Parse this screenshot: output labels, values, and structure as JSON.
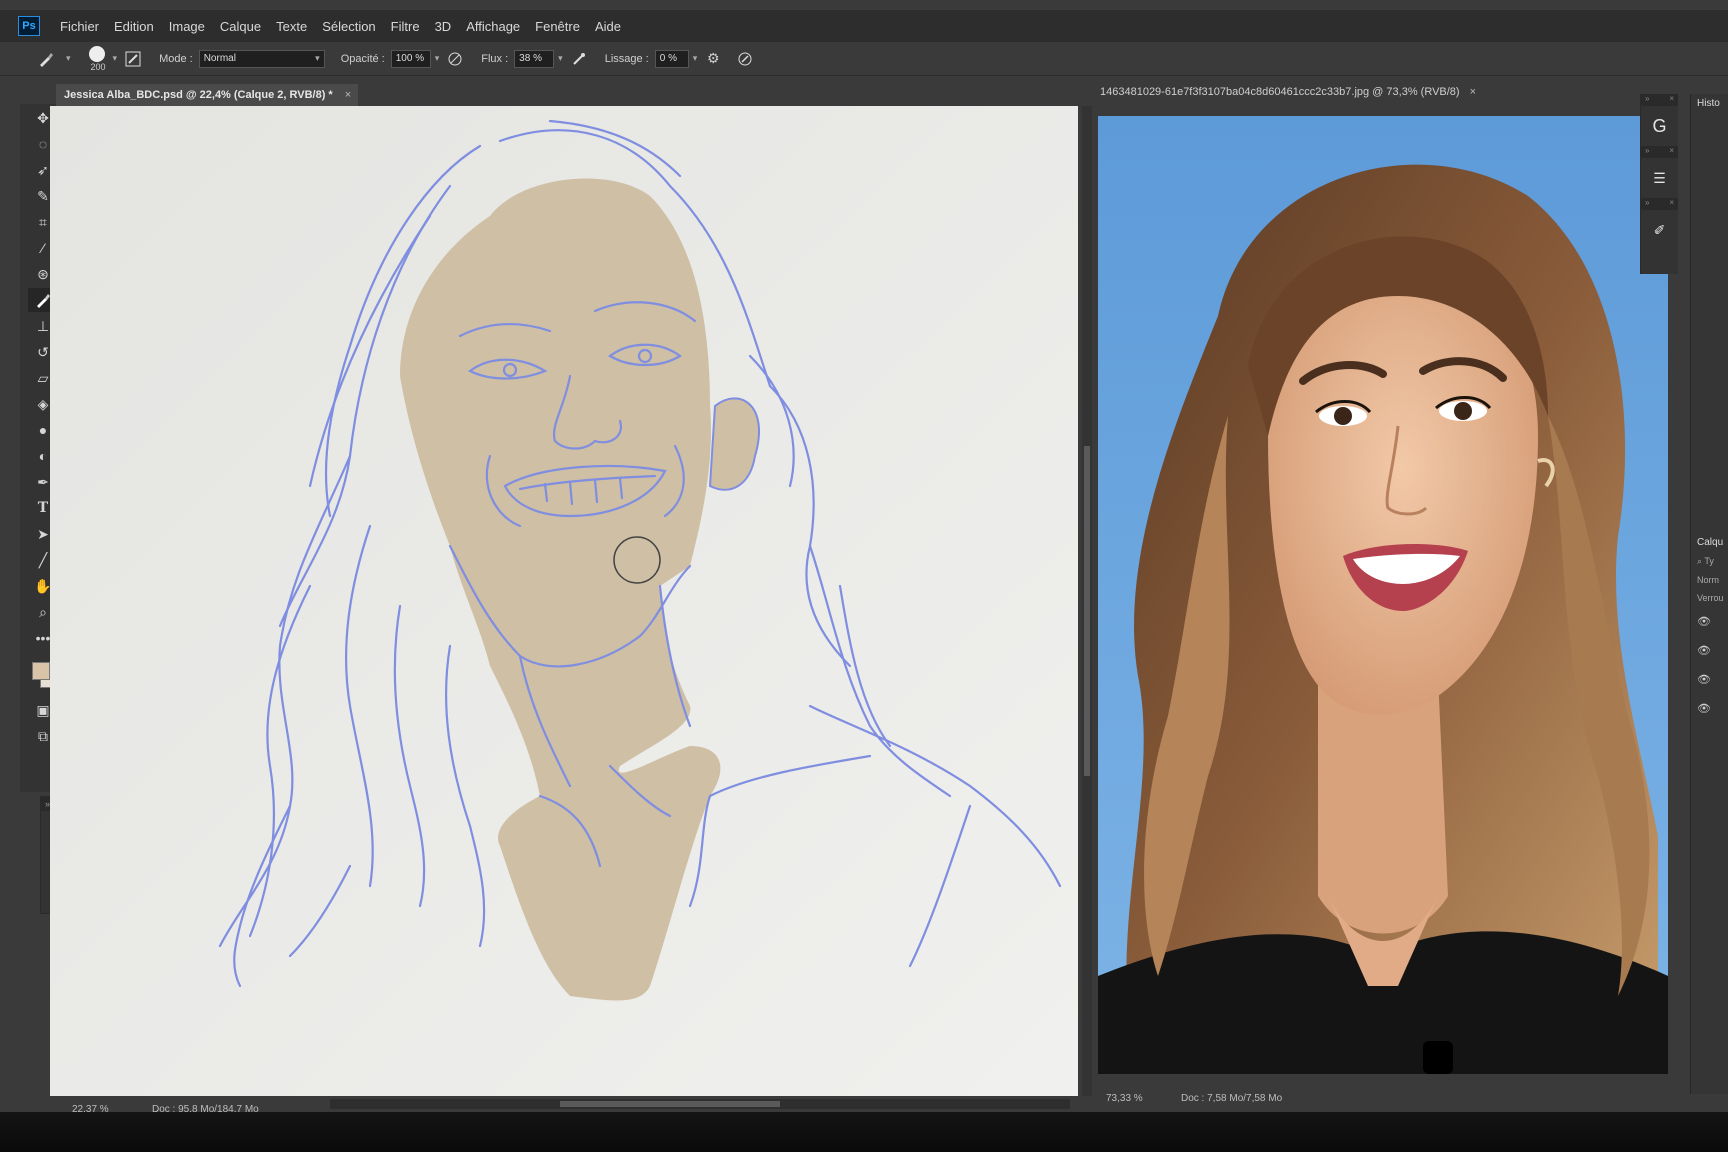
{
  "menubar": {
    "app_badge": "Ps",
    "items": [
      "Fichier",
      "Edition",
      "Image",
      "Calque",
      "Texte",
      "Sélection",
      "Filtre",
      "3D",
      "Affichage",
      "Fenêtre",
      "Aide"
    ]
  },
  "options": {
    "brush_size": "200",
    "mode_label": "Mode :",
    "mode_value": "Normal",
    "opacity_label": "Opacité :",
    "opacity_value": "100 %",
    "flow_label": "Flux :",
    "flow_value": "38 %",
    "smoothing_label": "Lissage :",
    "smoothing_value": "0 %"
  },
  "toolbar": {
    "tools": [
      "move-tool",
      "marquee-tool",
      "lasso-tool",
      "quick-selection-tool",
      "crop-tool",
      "eyedropper-tool",
      "spot-healing-tool",
      "brush-tool",
      "clone-stamp-tool",
      "history-brush-tool",
      "eraser-tool",
      "paint-bucket-tool",
      "blur-tool",
      "dodge-tool",
      "pen-tool",
      "type-tool",
      "path-selection-tool",
      "line-tool",
      "hand-tool",
      "zoom-tool",
      "more-tools"
    ],
    "active_tool": "brush-tool",
    "foreground_color": "#d9c4a8",
    "background_color": "#e8e0d4"
  },
  "doc1": {
    "tab_title": "Jessica Alba_BDC.psd @ 22,4% (Calque 2, RVB/8) *",
    "close": "×",
    "zoom": "22,37 %",
    "doc_info": "Doc : 95,8 Mo/184,7 Mo",
    "skin_color": "#cfbfa5",
    "sketch_color": "#7f8ee0"
  },
  "doc2": {
    "tab_title": "1463481029-61e7f3f3107ba04c8d60461ccc2c33b7.jpg @ 73,3% (RVB/8)",
    "close": "×",
    "zoom": "73,33 %",
    "doc_info": "Doc : 7,58 Mo/7,58 Mo",
    "backdrop_color": "#68a3dd"
  },
  "right_panels": {
    "history_label": "Histo",
    "layers_label": "Calqu",
    "search_label": "Ty",
    "blend_label": "Norm",
    "lock_label": "Verrou"
  }
}
